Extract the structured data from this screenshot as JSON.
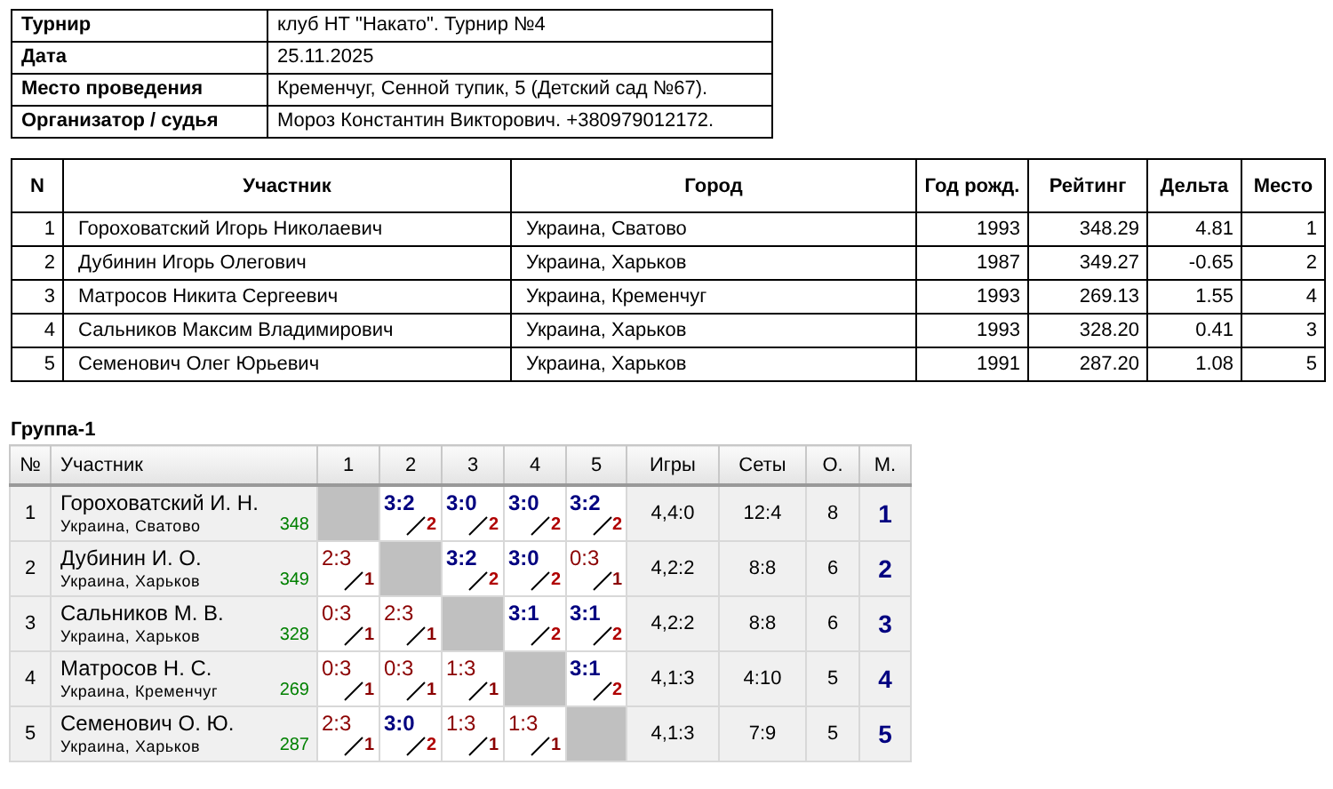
{
  "info": [
    {
      "label": "Турнир",
      "value": "клуб НТ \"Накато\". Турнир №4"
    },
    {
      "label": "Дата",
      "value": "25.11.2025"
    },
    {
      "label": "Место проведения",
      "value": "Кременчуг, Сенной тупик, 5 (Детский сад №67)."
    },
    {
      "label": "Организатор / судья",
      "value": "Мороз Константин Викторович. +380979012172."
    }
  ],
  "results": {
    "columns": [
      "N",
      "Участник",
      "Город",
      "Год рожд.",
      "Рейтинг",
      "Дельта",
      "Место"
    ],
    "rows": [
      [
        "1",
        "Гороховатский Игорь Николаевич",
        "Украина, Сватово",
        "1993",
        "348.29",
        "4.81",
        "1"
      ],
      [
        "2",
        "Дубинин Игорь Олегович",
        "Украина, Харьков",
        "1987",
        "349.27",
        "-0.65",
        "2"
      ],
      [
        "3",
        "Матросов Никита Сергеевич",
        "Украина, Кременчуг",
        "1993",
        "269.13",
        "1.55",
        "4"
      ],
      [
        "4",
        "Сальников Максим Владимирович",
        "Украина, Харьков",
        "1993",
        "328.20",
        "0.41",
        "3"
      ],
      [
        "5",
        "Семенович Олег Юрьевич",
        "Украина, Харьков",
        "1991",
        "287.20",
        "1.08",
        "5"
      ]
    ]
  },
  "group": {
    "title": "Группа-1",
    "columns": [
      "№",
      "Участник",
      "1",
      "2",
      "3",
      "4",
      "5",
      "Игры",
      "Сеты",
      "О.",
      "М."
    ],
    "rows": [
      [
        "1",
        {
          "name": "Гороховатский И. Н.",
          "city": "Украина, Сватово",
          "rating": "348"
        },
        {
          "kind": "self"
        },
        {
          "kind": "win",
          "score": "3:2",
          "pts": "2"
        },
        {
          "kind": "win",
          "score": "3:0",
          "pts": "2"
        },
        {
          "kind": "win",
          "score": "3:0",
          "pts": "2"
        },
        {
          "kind": "win",
          "score": "3:2",
          "pts": "2"
        },
        "4,4:0",
        "12:4",
        "8",
        "1"
      ],
      [
        "2",
        {
          "name": "Дубинин И. О.",
          "city": "Украина, Харьков",
          "rating": "349"
        },
        {
          "kind": "loss",
          "score": "2:3",
          "pts": "1"
        },
        {
          "kind": "self"
        },
        {
          "kind": "win",
          "score": "3:2",
          "pts": "2"
        },
        {
          "kind": "win",
          "score": "3:0",
          "pts": "2"
        },
        {
          "kind": "loss",
          "score": "0:3",
          "pts": "1"
        },
        "4,2:2",
        "8:8",
        "6",
        "2"
      ],
      [
        "3",
        {
          "name": "Сальников М. В.",
          "city": "Украина, Харьков",
          "rating": "328"
        },
        {
          "kind": "loss",
          "score": "0:3",
          "pts": "1"
        },
        {
          "kind": "loss",
          "score": "2:3",
          "pts": "1"
        },
        {
          "kind": "self"
        },
        {
          "kind": "win",
          "score": "3:1",
          "pts": "2"
        },
        {
          "kind": "win",
          "score": "3:1",
          "pts": "2"
        },
        "4,2:2",
        "8:8",
        "6",
        "3"
      ],
      [
        "4",
        {
          "name": "Матросов Н. С.",
          "city": "Украина, Кременчуг",
          "rating": "269"
        },
        {
          "kind": "loss",
          "score": "0:3",
          "pts": "1"
        },
        {
          "kind": "loss",
          "score": "0:3",
          "pts": "1"
        },
        {
          "kind": "loss",
          "score": "1:3",
          "pts": "1"
        },
        {
          "kind": "self"
        },
        {
          "kind": "win",
          "score": "3:1",
          "pts": "2"
        },
        "4,1:3",
        "4:10",
        "5",
        "4"
      ],
      [
        "5",
        {
          "name": "Семенович О. Ю.",
          "city": "Украина, Харьков",
          "rating": "287"
        },
        {
          "kind": "loss",
          "score": "2:3",
          "pts": "1"
        },
        {
          "kind": "win",
          "score": "3:0",
          "pts": "2"
        },
        {
          "kind": "loss",
          "score": "1:3",
          "pts": "1"
        },
        {
          "kind": "loss",
          "score": "1:3",
          "pts": "1"
        },
        {
          "kind": "self"
        },
        "4,1:3",
        "7:9",
        "5",
        "5"
      ]
    ]
  }
}
